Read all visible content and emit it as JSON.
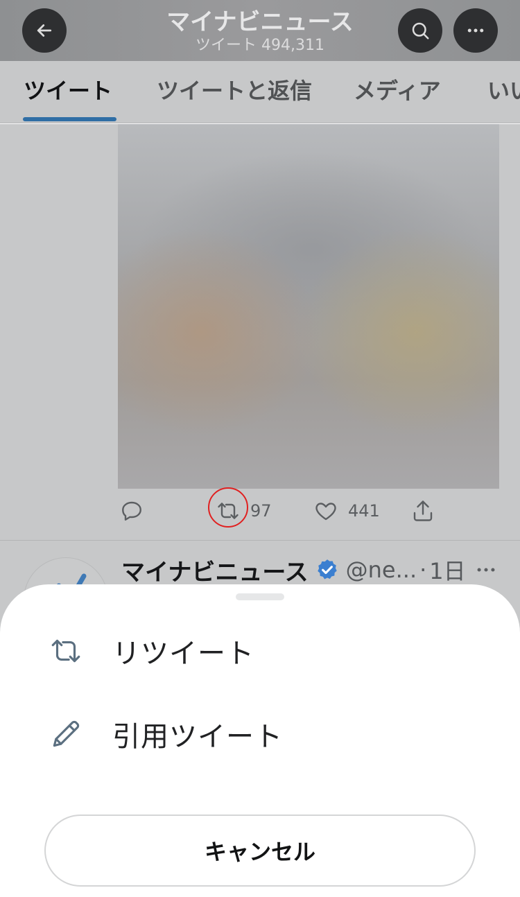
{
  "header": {
    "title": "マイナビニュース",
    "subtitle": "ツイート 494,311",
    "back_icon": "arrow-left-icon",
    "search_icon": "search-icon",
    "more_icon": "more-horizontal-icon"
  },
  "tabs": [
    {
      "label": "ツイート",
      "active": true
    },
    {
      "label": "ツイートと返信",
      "active": false
    },
    {
      "label": "メディア",
      "active": false
    },
    {
      "label": "いいね",
      "active": false
    }
  ],
  "tweet_actions": {
    "reply_icon": "reply-icon",
    "retweet_icon": "retweet-icon",
    "retweet_count": "97",
    "like_icon": "heart-icon",
    "like_count": "441",
    "share_icon": "share-icon"
  },
  "next_tweet": {
    "name": "マイナビニュース",
    "handle": "@ne...",
    "separator": "·",
    "time": "1日"
  },
  "sheet": {
    "options": [
      {
        "label": "リツイート",
        "icon": "retweet-icon"
      },
      {
        "label": "引用ツイート",
        "icon": "pencil-icon"
      }
    ],
    "cancel_label": "キャンセル"
  },
  "colors": {
    "accent": "#2f6ea5",
    "highlight_ring": "#e02020",
    "verified": "#3b7fd0"
  }
}
